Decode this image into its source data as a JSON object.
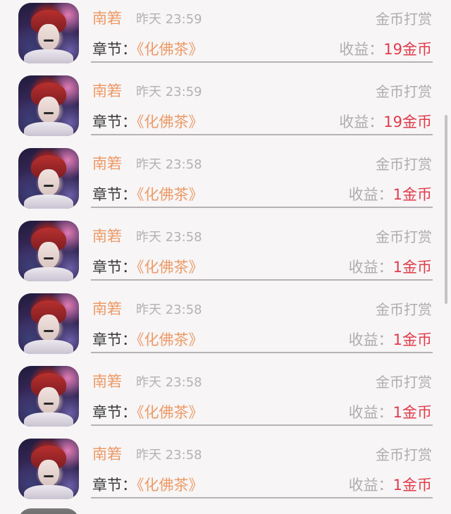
{
  "rows": [
    {
      "user": "南箬",
      "time": "昨天 23:59",
      "type": "金币打赏",
      "chapter_label": "章节：",
      "chapter_title": "《化佛茶》",
      "income_label": "收益：",
      "income_value": "19金币"
    },
    {
      "user": "南箬",
      "time": "昨天 23:59",
      "type": "金币打赏",
      "chapter_label": "章节：",
      "chapter_title": "《化佛茶》",
      "income_label": "收益：",
      "income_value": "19金币"
    },
    {
      "user": "南箬",
      "time": "昨天 23:58",
      "type": "金币打赏",
      "chapter_label": "章节：",
      "chapter_title": "《化佛茶》",
      "income_label": "收益：",
      "income_value": "1金币"
    },
    {
      "user": "南箬",
      "time": "昨天 23:58",
      "type": "金币打赏",
      "chapter_label": "章节：",
      "chapter_title": "《化佛茶》",
      "income_label": "收益：",
      "income_value": "1金币"
    },
    {
      "user": "南箬",
      "time": "昨天 23:58",
      "type": "金币打赏",
      "chapter_label": "章节：",
      "chapter_title": "《化佛茶》",
      "income_label": "收益：",
      "income_value": "1金币"
    },
    {
      "user": "南箬",
      "time": "昨天 23:58",
      "type": "金币打赏",
      "chapter_label": "章节：",
      "chapter_title": "《化佛茶》",
      "income_label": "收益：",
      "income_value": "1金币"
    },
    {
      "user": "南箬",
      "time": "昨天 23:58",
      "type": "金币打赏",
      "chapter_label": "章节：",
      "chapter_title": "《化佛茶》",
      "income_label": "收益：",
      "income_value": "1金币"
    }
  ],
  "colors": {
    "accent_orange": "#ec9a66",
    "income_red": "#e13b4b",
    "muted_gray": "#b0acad",
    "background": "#f7f5f6"
  }
}
